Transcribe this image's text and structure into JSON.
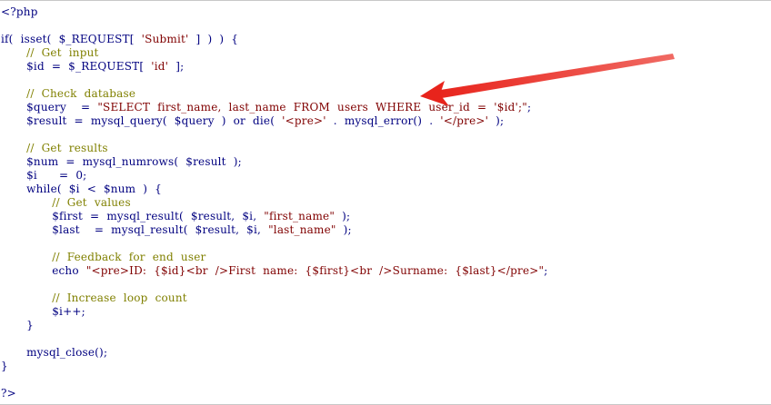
{
  "editor": {
    "lines": [
      [
        {
          "t": "<?php",
          "c": "kw"
        }
      ],
      [],
      [
        {
          "t": "if(  isset(  $_REQUEST[  ",
          "c": "kw"
        },
        {
          "t": "'Submit'",
          "c": "str"
        },
        {
          "t": "  ]  )  )  {",
          "c": "kw"
        }
      ],
      [
        {
          "t": "       ",
          "c": "kw"
        },
        {
          "t": "//  Get  input",
          "c": "com"
        }
      ],
      [
        {
          "t": "       $id  =  $_REQUEST[  ",
          "c": "var"
        },
        {
          "t": "'id'",
          "c": "str"
        },
        {
          "t": "  ];",
          "c": "var"
        }
      ],
      [],
      [
        {
          "t": "       ",
          "c": "kw"
        },
        {
          "t": "//  Check  database",
          "c": "com"
        }
      ],
      [
        {
          "t": "       $query    =  ",
          "c": "var"
        },
        {
          "t": "\"SELECT  first_name,  last_name  FROM  users  WHERE  user_id  =  '$id';\"",
          "c": "str"
        },
        {
          "t": ";",
          "c": "var"
        }
      ],
      [
        {
          "t": "       $result  =  mysql_query(  $query  )  or  die(  ",
          "c": "var"
        },
        {
          "t": "'<pre>'",
          "c": "str"
        },
        {
          "t": "  .  mysql_error()  .  ",
          "c": "var"
        },
        {
          "t": "'</pre>'",
          "c": "str"
        },
        {
          "t": "  );",
          "c": "var"
        }
      ],
      [],
      [
        {
          "t": "       ",
          "c": "kw"
        },
        {
          "t": "//  Get  results",
          "c": "com"
        }
      ],
      [
        {
          "t": "       $num  =  mysql_numrows(  $result  );",
          "c": "var"
        }
      ],
      [
        {
          "t": "       $i      =  0;",
          "c": "var"
        }
      ],
      [
        {
          "t": "       while(  $i  <  $num  )  {",
          "c": "kw"
        }
      ],
      [
        {
          "t": "              ",
          "c": "kw"
        },
        {
          "t": "//  Get  values",
          "c": "com"
        }
      ],
      [
        {
          "t": "              $first  =  mysql_result(  $result,  $i,  ",
          "c": "var"
        },
        {
          "t": "\"first_name\"",
          "c": "str"
        },
        {
          "t": "  );",
          "c": "var"
        }
      ],
      [
        {
          "t": "              $last    =  mysql_result(  $result,  $i,  ",
          "c": "var"
        },
        {
          "t": "\"last_name\"",
          "c": "str"
        },
        {
          "t": "  );",
          "c": "var"
        }
      ],
      [],
      [
        {
          "t": "              ",
          "c": "kw"
        },
        {
          "t": "//  Feedback  for  end  user",
          "c": "com"
        }
      ],
      [
        {
          "t": "              echo  ",
          "c": "kw"
        },
        {
          "t": "\"<pre>ID:  {$id}<br  />First  name:  {$first}<br  />Surname:  {$last}</pre>\"",
          "c": "str"
        },
        {
          "t": ";",
          "c": "var"
        }
      ],
      [],
      [
        {
          "t": "              ",
          "c": "kw"
        },
        {
          "t": "//  Increase  loop  count",
          "c": "com"
        }
      ],
      [
        {
          "t": "              $i++;",
          "c": "var"
        }
      ],
      [
        {
          "t": "       }",
          "c": "kw"
        }
      ],
      [],
      [
        {
          "t": "       mysql_close();",
          "c": "fn"
        }
      ],
      [
        {
          "t": "}",
          "c": "kw"
        }
      ],
      [],
      [
        {
          "t": "?>",
          "c": "kw"
        }
      ]
    ]
  },
  "annotation": {
    "arrow_color": "#e8241c",
    "points_to": "WHERE  user_id  =  '$id'"
  }
}
